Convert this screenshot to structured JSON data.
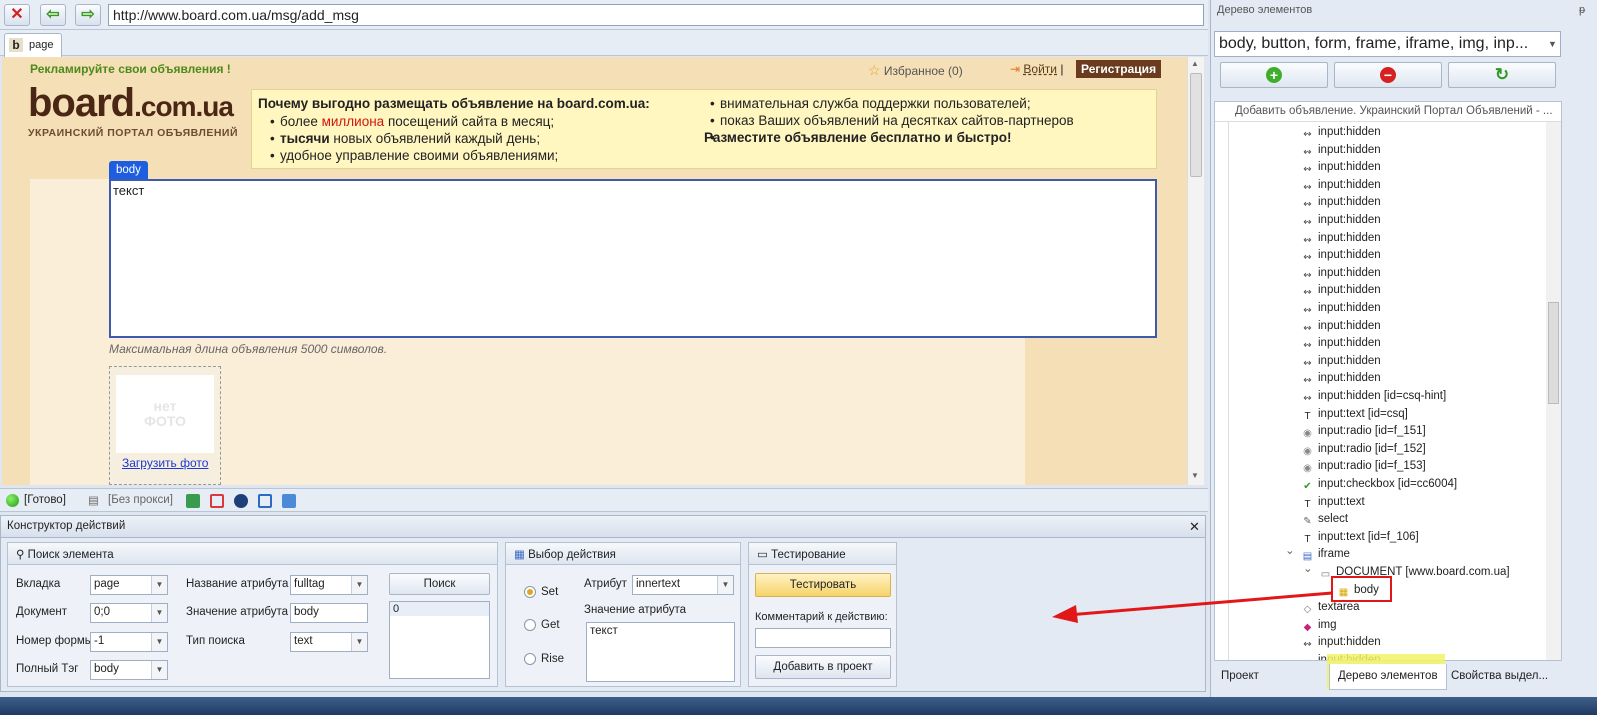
{
  "browser": {
    "url": "http://www.board.com.ua/msg/add_msg",
    "tab_label": "page",
    "tab_icon": "b"
  },
  "webpage": {
    "promo": "Рекламируйте свои объявления !",
    "favorites": "Избранное (0)",
    "login": "Войти",
    "separator": "|",
    "register": "Регистрация",
    "logo_main": "board",
    "logo_domain": ".com.ua",
    "logo_sub": "УКРАИНСКИЙ ПОРТАЛ ОБЪЯВЛЕНИЙ",
    "why_title": "Почему выгодно размещать объявление на board.com.ua:",
    "why_left": [
      {
        "pre": "более ",
        "hl": "миллиона",
        "post": " посещений сайта в месяц;"
      },
      {
        "bold": "тысячи",
        "post": " новых объявлений каждый день;"
      },
      {
        "post": "удобное управление своими объявлениями;"
      }
    ],
    "why_right": [
      "внимательная служба поддержки пользователей;",
      "показ Ваших объявлений на десятках сайтов-партнеров"
    ],
    "why_cta": "Разместите объявление бесплатно и быстро!",
    "body_tag": "body",
    "editor_text": "текст",
    "max_length_note": "Максимальная длина объявления 5000 символов.",
    "no_photo_1": "нет",
    "no_photo_2": "ФОТО",
    "upload_photo": "Загрузить фото"
  },
  "status": {
    "ready": "[Готово]",
    "proxy": "[Без прокси]"
  },
  "constructor": {
    "title": "Конструктор действий",
    "search_group": "Поиск элемента",
    "tab_label": "Вкладка",
    "tab_value": "page",
    "document_label": "Документ",
    "document_value": "0;0",
    "form_label": "Номер формы",
    "form_value": "-1",
    "fulltag_label": "Полный Тэг",
    "fulltag_value": "body",
    "attr_name_label": "Название атрибута",
    "attr_name_value": "fulltag",
    "attr_value_label": "Значение атрибута",
    "attr_value_value": "body",
    "search_type_label": "Тип поиска",
    "search_type_value": "text",
    "search_button": "Поиск",
    "result_item": "0",
    "action_group": "Выбор действия",
    "radio_set": "Set",
    "radio_get": "Get",
    "radio_rise": "Rise",
    "attribute_label": "Атрибут",
    "attribute_value": "innertext",
    "attr_val_label": "Значение атрибута",
    "attr_val_text": "текст",
    "testing_group": "Тестирование",
    "test_button": "Тестировать",
    "comment_label": "Комментарий к действию:",
    "comment_value": "",
    "add_project_button": "Добавить в проект"
  },
  "element_tree": {
    "title": "Дерево элементов",
    "pin": "ᵽ",
    "filter": "body, button, form, frame, iframe, img, inp...",
    "header": "Добавить объявление. Украинский Портал Объявлений - ...",
    "nodes": [
      {
        "label": "input:hidden",
        "icon": "hidden-icon",
        "glyph": "↭",
        "indent": 86
      },
      {
        "label": "input:hidden",
        "icon": "hidden-icon",
        "glyph": "↭",
        "indent": 86
      },
      {
        "label": "input:hidden",
        "icon": "hidden-icon",
        "glyph": "↭",
        "indent": 86
      },
      {
        "label": "input:hidden",
        "icon": "hidden-icon",
        "glyph": "↭",
        "indent": 86
      },
      {
        "label": "input:hidden",
        "icon": "hidden-icon",
        "glyph": "↭",
        "indent": 86
      },
      {
        "label": "input:hidden",
        "icon": "hidden-icon",
        "glyph": "↭",
        "indent": 86
      },
      {
        "label": "input:hidden",
        "icon": "hidden-icon",
        "glyph": "↭",
        "indent": 86
      },
      {
        "label": "input:hidden",
        "icon": "hidden-icon",
        "glyph": "↭",
        "indent": 86
      },
      {
        "label": "input:hidden",
        "icon": "hidden-icon",
        "glyph": "↭",
        "indent": 86
      },
      {
        "label": "input:hidden",
        "icon": "hidden-icon",
        "glyph": "↭",
        "indent": 86
      },
      {
        "label": "input:hidden",
        "icon": "hidden-icon",
        "glyph": "↭",
        "indent": 86
      },
      {
        "label": "input:hidden",
        "icon": "hidden-icon",
        "glyph": "↭",
        "indent": 86
      },
      {
        "label": "input:hidden",
        "icon": "hidden-icon",
        "glyph": "↭",
        "indent": 86
      },
      {
        "label": "input:hidden",
        "icon": "hidden-icon",
        "glyph": "↭",
        "indent": 86
      },
      {
        "label": "input:hidden",
        "icon": "hidden-icon",
        "glyph": "↭",
        "indent": 86
      },
      {
        "label": "input:hidden [id=csq-hint]",
        "icon": "hidden-icon",
        "glyph": "↭",
        "indent": 86
      },
      {
        "label": "input:text [id=csq]",
        "icon": "text-input-icon",
        "glyph": "T",
        "indent": 86
      },
      {
        "label": "input:radio [id=f_151]",
        "icon": "radio-icon",
        "glyph": "◉",
        "indent": 86
      },
      {
        "label": "input:radio [id=f_152]",
        "icon": "radio-icon",
        "glyph": "◉",
        "indent": 86
      },
      {
        "label": "input:radio [id=f_153]",
        "icon": "radio-icon",
        "glyph": "◉",
        "indent": 86
      },
      {
        "label": "input:checkbox [id=cc6004]",
        "icon": "checkbox-icon",
        "glyph": "✔",
        "indent": 86
      },
      {
        "label": "input:text",
        "icon": "text-input-icon",
        "glyph": "T",
        "indent": 86
      },
      {
        "label": "select",
        "icon": "select-icon",
        "glyph": "✎",
        "indent": 86
      },
      {
        "label": "input:text [id=f_106]",
        "icon": "text-input-icon",
        "glyph": "T",
        "indent": 86
      },
      {
        "label": "iframe",
        "icon": "iframe-icon",
        "glyph": "▤",
        "indent": 86,
        "expander": "⌄"
      },
      {
        "label": "DOCUMENT [www.board.com.ua]",
        "icon": "document-icon",
        "glyph": "▭",
        "indent": 104,
        "expander": "⌄"
      },
      {
        "label": "body",
        "icon": "body-icon",
        "glyph": "▦",
        "indent": 122
      },
      {
        "label": "textarea",
        "icon": "textarea-icon",
        "glyph": "◇",
        "indent": 86
      },
      {
        "label": "img",
        "icon": "image-icon",
        "glyph": "◆",
        "indent": 86
      },
      {
        "label": "input:hidden",
        "icon": "hidden-icon",
        "glyph": "↭",
        "indent": 86
      },
      {
        "label": "input:hidden",
        "icon": "hidden-icon",
        "glyph": "↭",
        "indent": 86
      }
    ],
    "bottom_tabs": [
      "Проект",
      "Дерево элементов",
      "Свойства выдел..."
    ]
  },
  "colors": {
    "highlight": "#e21818",
    "tab_highlight": "#f3f366",
    "page_bg": "#f5dfb6",
    "body_tag": "#1d5ee0"
  }
}
